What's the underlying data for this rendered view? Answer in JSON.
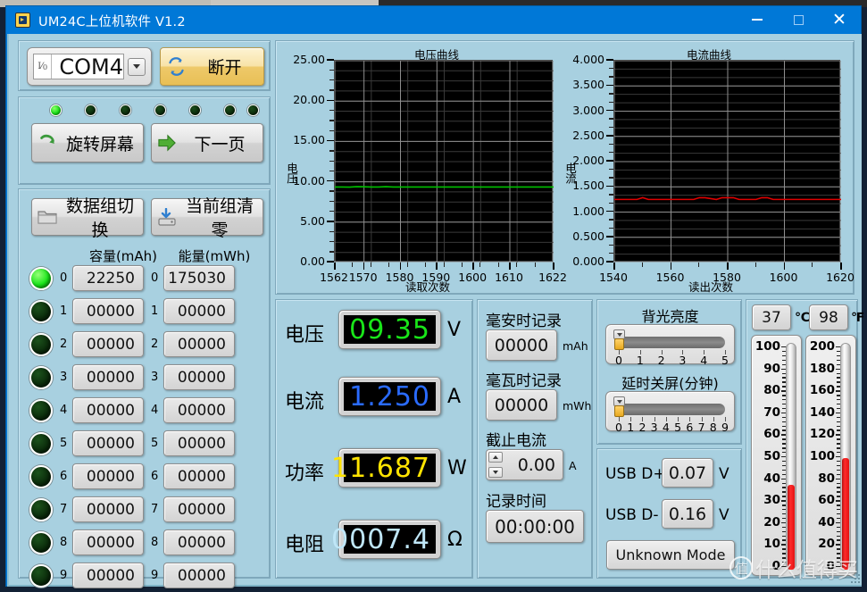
{
  "window": {
    "title": "UM24C上位机软件 V1.2",
    "icon": "app-icon",
    "minimize": "—",
    "maximize": "□",
    "close": "✕"
  },
  "connection": {
    "port_value": "COM4",
    "port_icon": "io-icon",
    "dropdown_icon": "chevron-down-icon",
    "disconnect_label": "断开",
    "disconnect_icon": "refresh-icon"
  },
  "status_leds": [
    {
      "state": "on"
    },
    {
      "state": "off"
    },
    {
      "state": "off"
    },
    {
      "state": "off"
    },
    {
      "state": "off"
    },
    {
      "state": "off"
    },
    {
      "state": "off"
    }
  ],
  "screen_controls": {
    "rotate_label": "旋转屏幕",
    "rotate_icon": "rotate-arrow-icon",
    "next_page_label": "下一页",
    "next_page_icon": "right-arrow-icon"
  },
  "group_controls": {
    "switch_label": "数据组切换",
    "switch_icon": "folder-icon",
    "clear_label": "当前组清零",
    "clear_icon": "save-down-icon"
  },
  "groups": {
    "capacity_header": "容量(mAh)",
    "energy_header": "能量(mWh)",
    "rows": [
      {
        "index": "0",
        "led": "on",
        "capacity": "22250",
        "energy": "175030"
      },
      {
        "index": "1",
        "led": "off",
        "capacity": "00000",
        "energy": "00000"
      },
      {
        "index": "2",
        "led": "off",
        "capacity": "00000",
        "energy": "00000"
      },
      {
        "index": "3",
        "led": "off",
        "capacity": "00000",
        "energy": "00000"
      },
      {
        "index": "4",
        "led": "off",
        "capacity": "00000",
        "energy": "00000"
      },
      {
        "index": "5",
        "led": "off",
        "capacity": "00000",
        "energy": "00000"
      },
      {
        "index": "6",
        "led": "off",
        "capacity": "00000",
        "energy": "00000"
      },
      {
        "index": "7",
        "led": "off",
        "capacity": "00000",
        "energy": "00000"
      },
      {
        "index": "8",
        "led": "off",
        "capacity": "00000",
        "energy": "00000"
      },
      {
        "index": "9",
        "led": "off",
        "capacity": "00000",
        "energy": "00000"
      }
    ]
  },
  "chart_data": [
    {
      "type": "line",
      "name": "voltage-chart",
      "title": "电压曲线",
      "xlabel": "读取次数",
      "ylabel": "电压",
      "xlim": [
        1562,
        1622
      ],
      "ylim": [
        0,
        25
      ],
      "yticks": [
        "25.00",
        "20.00",
        "15.00",
        "10.00",
        "5.00",
        "0.00"
      ],
      "ytick_values": [
        25,
        20,
        15,
        10,
        5,
        0
      ],
      "xticks": [
        "1562",
        "1570",
        "1580",
        "1590",
        "1600",
        "1610",
        "1622"
      ],
      "xtick_values": [
        1562,
        1570,
        1580,
        1590,
        1600,
        1610,
        1622
      ],
      "grid": true,
      "series": [
        {
          "name": "电压",
          "color": "#00c000",
          "x": [
            1562,
            1564,
            1566,
            1568,
            1570,
            1572,
            1574,
            1576,
            1578,
            1580,
            1582,
            1584,
            1586,
            1588,
            1590,
            1592,
            1594,
            1596,
            1598,
            1600,
            1602,
            1604,
            1606,
            1608,
            1610,
            1612,
            1614,
            1616,
            1618,
            1620,
            1622
          ],
          "values": [
            9.35,
            9.36,
            9.34,
            9.4,
            9.38,
            9.35,
            9.35,
            9.4,
            9.36,
            9.35,
            9.35,
            9.35,
            9.35,
            9.35,
            9.35,
            9.35,
            9.35,
            9.35,
            9.35,
            9.35,
            9.35,
            9.35,
            9.35,
            9.35,
            9.35,
            9.35,
            9.35,
            9.35,
            9.35,
            9.35,
            9.35
          ]
        }
      ]
    },
    {
      "type": "line",
      "name": "current-chart",
      "title": "电流曲线",
      "xlabel": "读出次数",
      "ylabel": "电流",
      "xlim": [
        1540,
        1620
      ],
      "ylim": [
        0,
        4
      ],
      "yticks": [
        "4.000",
        "3.500",
        "3.000",
        "2.500",
        "2.000",
        "1.500",
        "1.000",
        "0.500",
        "0.000"
      ],
      "ytick_values": [
        4,
        3.5,
        3,
        2.5,
        2,
        1.5,
        1,
        0.5,
        0
      ],
      "xticks": [
        "1540",
        "1560",
        "1580",
        "1600",
        "1620"
      ],
      "xtick_values": [
        1540,
        1560,
        1580,
        1600,
        1620
      ],
      "grid": true,
      "series": [
        {
          "name": "电流",
          "color": "#e00000",
          "x": [
            1540,
            1544,
            1548,
            1550,
            1552,
            1556,
            1560,
            1564,
            1568,
            1570,
            1572,
            1576,
            1578,
            1580,
            1582,
            1584,
            1588,
            1590,
            1592,
            1594,
            1596,
            1600,
            1604,
            1608,
            1612,
            1616,
            1620
          ],
          "values": [
            1.25,
            1.25,
            1.25,
            1.285,
            1.25,
            1.25,
            1.25,
            1.25,
            1.25,
            1.285,
            1.285,
            1.25,
            1.285,
            1.285,
            1.285,
            1.25,
            1.25,
            1.25,
            1.285,
            1.285,
            1.25,
            1.25,
            1.25,
            1.25,
            1.25,
            1.25,
            1.25
          ]
        }
      ]
    }
  ],
  "measurements": [
    {
      "label": "电压",
      "value": "09.35",
      "unit": "V",
      "color": "#19e519"
    },
    {
      "label": "电流",
      "value": "1.250",
      "unit": "A",
      "color": "#2a6bff"
    },
    {
      "label": "功率",
      "value": "11.687",
      "unit": "W",
      "color": "#ffe400"
    },
    {
      "label": "电阻",
      "value": "0007.4",
      "unit": "Ω",
      "color": "#bfe6f7"
    }
  ],
  "recording": {
    "mah_label": "毫安时记录",
    "mah_value": "00000",
    "mah_unit": "mAh",
    "mwh_label": "毫瓦时记录",
    "mwh_value": "00000",
    "mwh_unit": "mWh",
    "cutoff_label": "截止电流",
    "cutoff_value": "0.00",
    "cutoff_unit": "A",
    "time_label": "记录时间",
    "time_value": "00:00:00"
  },
  "backlight": {
    "title": "背光亮度",
    "value": 0,
    "ticks": [
      "0",
      "1",
      "2",
      "3",
      "4",
      "5"
    ]
  },
  "screen_off": {
    "title": "延时关屏(分钟)",
    "value": 0,
    "ticks": [
      "0",
      "1",
      "2",
      "3",
      "4",
      "5",
      "6",
      "7",
      "8",
      "9"
    ]
  },
  "usb": {
    "dplus_label": "USB D+",
    "dplus_value": "0.07",
    "dplus_unit": "V",
    "dminus_label": "USB D-",
    "dminus_value": "0.16",
    "dminus_unit": "V",
    "mode": "Unknown Mode"
  },
  "temperature": {
    "celsius_value": "37",
    "celsius_unit": "℃",
    "fahrenheit_value": "98",
    "fahrenheit_unit": "℉",
    "celsius_num": 37,
    "fahrenheit_num": 98,
    "celsius_max": 100,
    "fahrenheit_max": 200,
    "celsius_ticks": [
      "100",
      "90",
      "80",
      "70",
      "60",
      "50",
      "40",
      "30",
      "20",
      "10",
      "0"
    ],
    "fahrenheit_ticks": [
      "200",
      "180",
      "160",
      "140",
      "120",
      "100",
      "80",
      "60",
      "40",
      "20",
      "0"
    ]
  },
  "watermark": {
    "mark": "值",
    "text": "什么值得买"
  }
}
